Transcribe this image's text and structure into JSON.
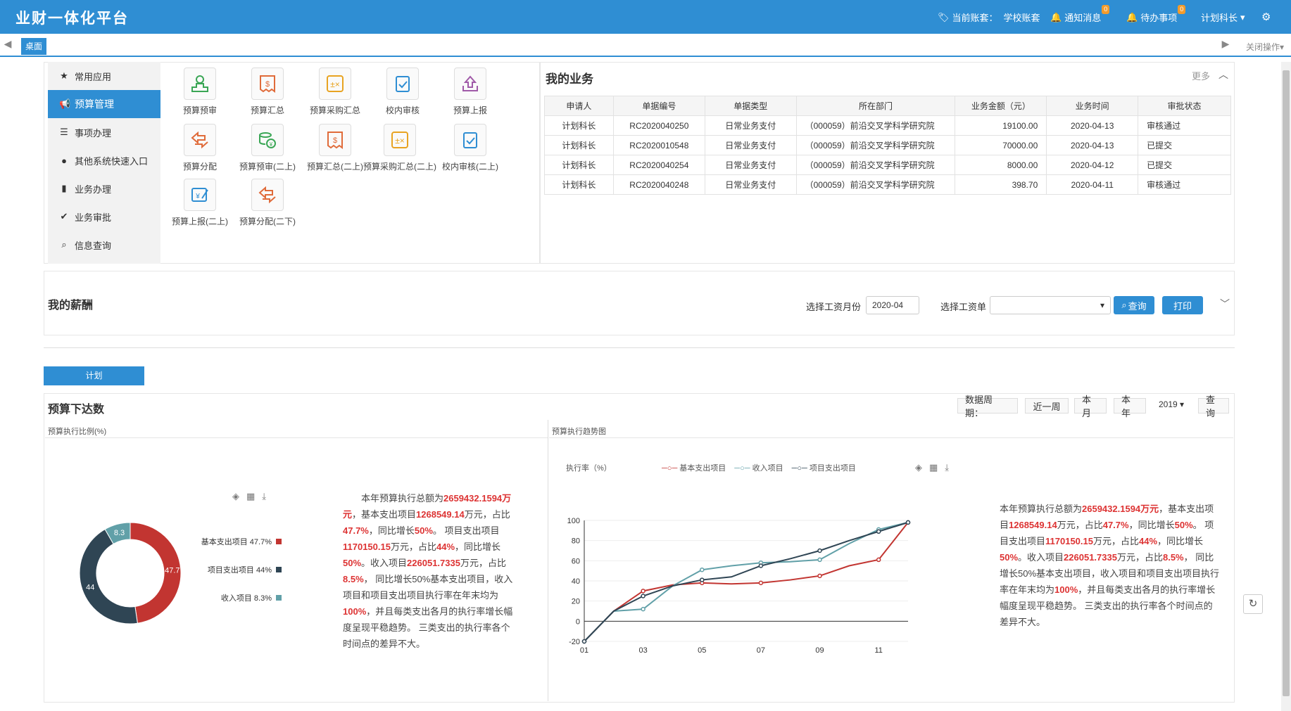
{
  "app": {
    "title": "业财一体化平台"
  },
  "topnav": {
    "account_label": "当前账套：",
    "account_value": "学校账套",
    "notice": "通知消息",
    "notice_count": "0",
    "todo": "待办事项",
    "todo_count": "0",
    "user": "计划科长"
  },
  "tabs": {
    "desk": "桌面",
    "close_ops": "关闭操作"
  },
  "sidebar": {
    "items": [
      {
        "label": "常用应用",
        "icon": "★"
      },
      {
        "label": "预算管理",
        "icon": "📢"
      },
      {
        "label": "事项办理",
        "icon": "☰"
      },
      {
        "label": "其他系统快速入口",
        "icon": "●"
      },
      {
        "label": "业务办理",
        "icon": "▮"
      },
      {
        "label": "业务审批",
        "icon": "✔"
      },
      {
        "label": "信息查询",
        "icon": "⌕"
      }
    ]
  },
  "apps": [
    {
      "label": "预算预审",
      "color": "#3aa655"
    },
    {
      "label": "预算汇总",
      "color": "#e06b3a"
    },
    {
      "label": "预算采购汇总",
      "color": "#e8a321"
    },
    {
      "label": "校内审核",
      "color": "#2f8ed3"
    },
    {
      "label": "预算上报",
      "color": "#a05aa8"
    },
    {
      "label": "预算分配",
      "color": "#e06b3a"
    },
    {
      "label": "预算预审(二上)",
      "color": "#3aa655"
    },
    {
      "label": "预算汇总(二上)",
      "color": "#e06b3a"
    },
    {
      "label": "预算采购汇总(二上)",
      "color": "#e8a321"
    },
    {
      "label": "校内审核(二上)",
      "color": "#2f8ed3"
    },
    {
      "label": "预算上报(二上)",
      "color": "#2f8ed3"
    },
    {
      "label": "预算分配(二下)",
      "color": "#e06b3a"
    }
  ],
  "biz": {
    "title": "我的业务",
    "more": "更多",
    "columns": [
      "申请人",
      "单据编号",
      "单据类型",
      "所在部门",
      "业务金额（元）",
      "业务时间",
      "审批状态"
    ],
    "rows": [
      [
        "计划科长",
        "RC2020040250",
        "日常业务支付",
        "（000059）前沿交叉学科学研究院",
        "19100.00",
        "2020-04-13",
        "审核通过"
      ],
      [
        "计划科长",
        "RC2020010548",
        "日常业务支付",
        "（000059）前沿交叉学科学研究院",
        "70000.00",
        "2020-04-13",
        "已提交"
      ],
      [
        "计划科长",
        "RC2020040254",
        "日常业务支付",
        "（000059）前沿交叉学科学研究院",
        "8000.00",
        "2020-04-12",
        "已提交"
      ],
      [
        "计划科长",
        "RC2020040248",
        "日常业务支付",
        "（000059）前沿交叉学科学研究院",
        "398.70",
        "2020-04-11",
        "审核通过"
      ]
    ]
  },
  "salary": {
    "title": "我的薪酬",
    "month_label": "选择工资月份",
    "month_value": "2020-04",
    "sheet_label": "选择工资单",
    "query": "查询",
    "print": "打印"
  },
  "plan_tab": "计划",
  "budget": {
    "title": "预算下达数",
    "period_label": "数据周期：",
    "week": "近一周",
    "month": "本月",
    "year": "本年",
    "year_value": "2019",
    "query": "查询",
    "left_title": "预算执行比例(%)",
    "right_title": "预算执行趋势图",
    "legend_pie": [
      "基本支出项目 47.7%",
      "项目支出项目 44%",
      "收入项目 8.3%"
    ],
    "pie_labels": [
      "47.7",
      "44",
      "8.3"
    ],
    "desc": {
      "p1": "本年预算执行总额为",
      "total": "2659432.1594万元",
      "p2": "，基本支出项目",
      "basic": "1268549.14",
      "p3": "万元，占比",
      "basic_pct": "47.7%",
      "p4": "，同比增长",
      "basic_grow": "50%",
      "p5": "。 项目支出项目",
      "proj": "1170150.15",
      "p6": "万元，占比",
      "proj_pct": "44%",
      "p7": "，同比增长",
      "proj_grow": "50%",
      "p8": "。收入项目",
      "income": "226051.7335",
      "p9": "万元，占比",
      "income_pct": "8.5%",
      "p10": "， 同比增长50%基本支出项目，收入项目和项目支出项目执行率在年末均为",
      "end": "100%",
      "p11": "，并且每类支出各月的执行率增长幅度呈现平稳趋势。 三类支出的执行率各个时间点的差异不大。"
    },
    "line_ylabel": "执行率（%）",
    "line_legend": [
      "基本支出项目",
      "收入项目",
      "项目支出项目"
    ]
  },
  "chart_data": [
    {
      "type": "pie",
      "title": "预算执行比例(%)",
      "categories": [
        "基本支出项目",
        "项目支出项目",
        "收入项目"
      ],
      "values": [
        47.7,
        44,
        8.3
      ],
      "colors": [
        "#c23531",
        "#2f4554",
        "#61a0a8"
      ]
    },
    {
      "type": "line",
      "title": "预算执行趋势图",
      "ylabel": "执行率（%）",
      "x": [
        "01",
        "02",
        "03",
        "04",
        "05",
        "06",
        "07",
        "08",
        "09",
        "10",
        "11",
        "12"
      ],
      "xticks": [
        "01",
        "03",
        "05",
        "07",
        "09",
        "11"
      ],
      "ylim": [
        -20,
        100
      ],
      "yticks": [
        -20,
        0,
        20,
        40,
        60,
        80,
        100
      ],
      "series": [
        {
          "name": "基本支出项目",
          "color": "#c23531",
          "values": [
            -20,
            10,
            30,
            36,
            38,
            37,
            38,
            41,
            45,
            55,
            61,
            98
          ]
        },
        {
          "name": "收入项目",
          "color": "#61a0a8",
          "values": [
            -20,
            10,
            12,
            35,
            51,
            55,
            58,
            59,
            61,
            77,
            91,
            98
          ]
        },
        {
          "name": "项目支出项目",
          "color": "#2f4554",
          "values": [
            -20,
            10,
            25,
            35,
            41,
            44,
            55,
            62,
            70,
            80,
            89,
            98
          ]
        }
      ]
    }
  ]
}
